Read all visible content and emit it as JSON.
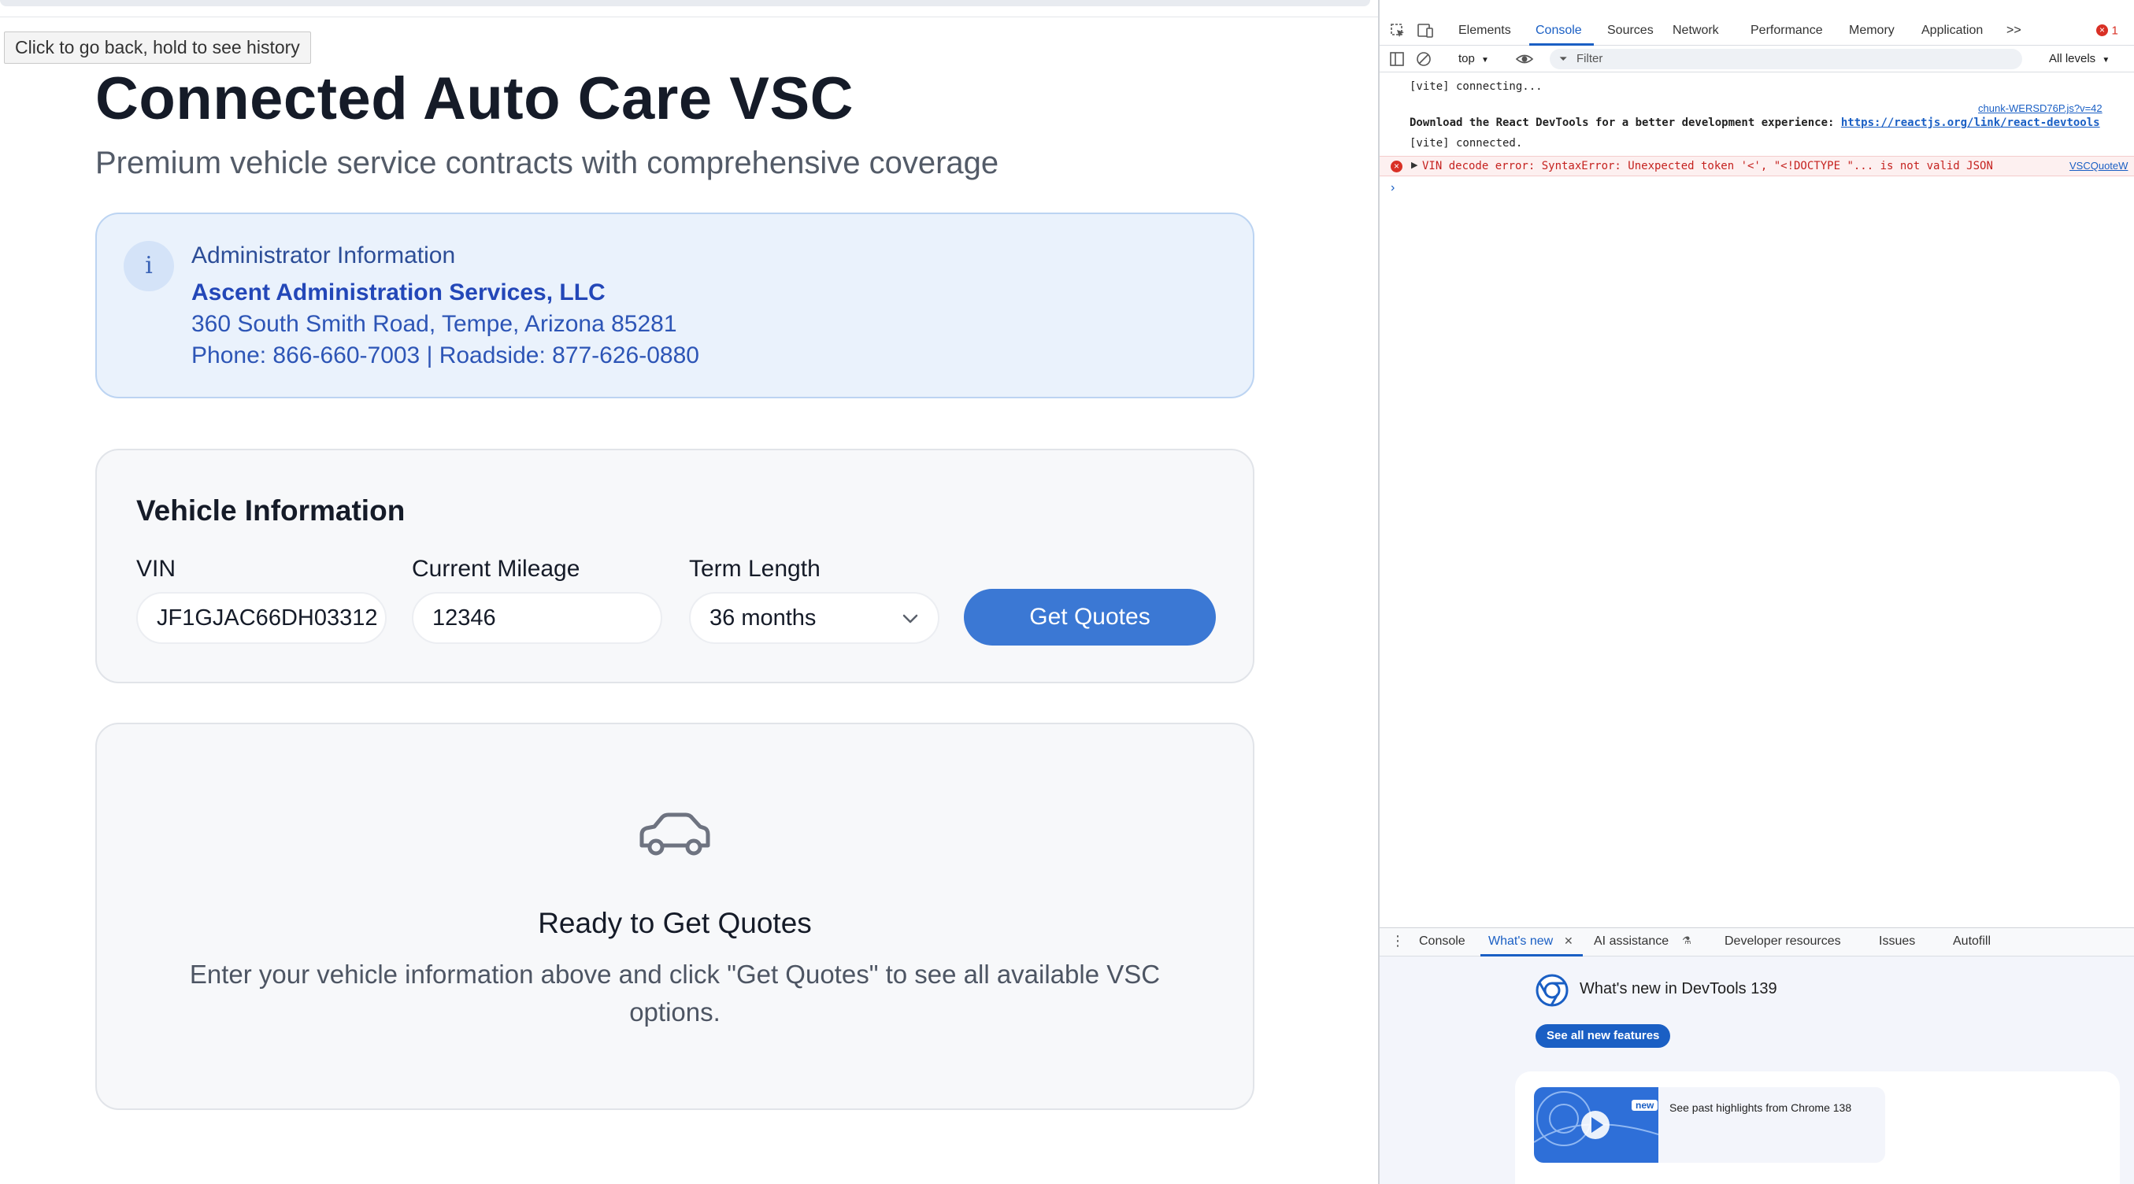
{
  "tooltip": "Click to go back, hold to see history",
  "page": {
    "title": "Connected Auto Care VSC",
    "subtitle": "Premium vehicle service contracts with comprehensive coverage"
  },
  "admin": {
    "icon": "i",
    "heading": "Administrator Information",
    "company": "Ascent Administration Services, LLC",
    "address": "360 South Smith Road, Tempe, Arizona 85281",
    "phone": "Phone: 866-660-7003 | Roadside: 877-626-0880"
  },
  "vehicle": {
    "heading": "Vehicle Information",
    "vin_label": "VIN",
    "vin_value": "JF1GJAC66DH03312",
    "mileage_label": "Current Mileage",
    "mileage_value": "12346",
    "term_label": "Term Length",
    "term_value": "36 months",
    "submit_label": "Get Quotes"
  },
  "ready": {
    "title": "Ready to Get Quotes",
    "text": "Enter your vehicle information above and click \"Get Quotes\" to see all available VSC options."
  },
  "devtools": {
    "tabs": [
      "Elements",
      "Console",
      "Sources",
      "Network",
      "Performance",
      "Memory",
      "Application"
    ],
    "more": ">>",
    "error_badge": "1",
    "context": "top",
    "filter_placeholder": "Filter",
    "levels": "All levels",
    "logs": {
      "line1": "[vite] connecting...",
      "source1": "chunk-WERSD76P.js?v=42",
      "line2_prefix": "Download the React DevTools for a better development experience: ",
      "line2_link": "https://reactjs.org/link/react-devtools",
      "line3": "[vite] connected.",
      "error": "VIN decode error: SyntaxError: Unexpected token '<', \"<!DOCTYPE \"... is not valid JSON",
      "error_source": "VSCQuoteW"
    },
    "drawer_tabs": [
      "Console",
      "What's new",
      "AI assistance",
      "Developer resources",
      "Issues",
      "Autofill"
    ],
    "whatsnew_title": "What's new in DevTools 139",
    "see_all": "See all new features",
    "new_badge": "new",
    "highlight": "See past highlights from Chrome 138"
  },
  "colors": {
    "accent": "#3b78d4",
    "admin_bg": "#eaf2fc",
    "devtools_accent": "#1a5fc4"
  }
}
